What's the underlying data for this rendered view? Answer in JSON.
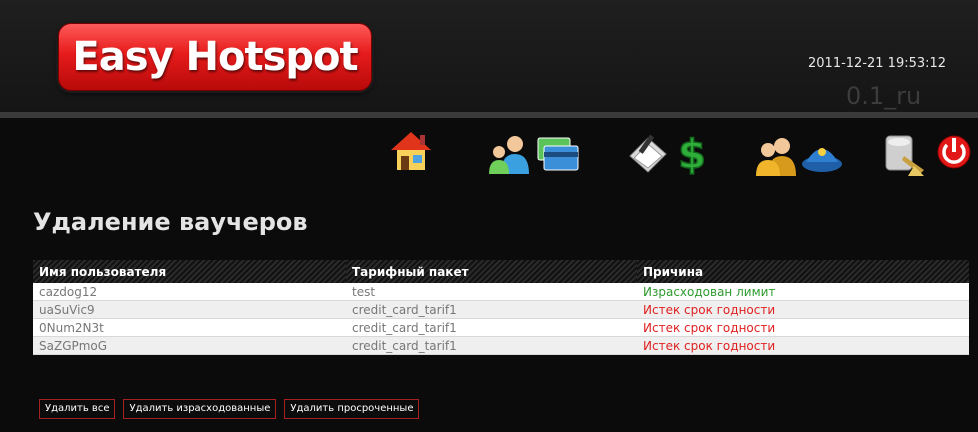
{
  "header": {
    "logo_text": "Easy Hotspot",
    "datetime": "2011-12-21 19:53:12",
    "version": "0.1_ru"
  },
  "toolbar": {
    "icons": [
      "home-icon",
      "users-icon",
      "cards-icon",
      "vouchers-icon",
      "billing-icon",
      "accounts-icon",
      "admin-icon",
      "maintenance-icon",
      "power-icon"
    ]
  },
  "page_title": "Удаление ваучеров",
  "table": {
    "headers": [
      "Имя пользователя",
      "Тарифный пакет",
      "Причина"
    ],
    "rows": [
      {
        "user": "cazdog12",
        "plan": "test",
        "reason": "Израсходован лимит"
      },
      {
        "user": "uaSuVic9",
        "plan": "credit_card_tarif1",
        "reason": "Истек срок годности"
      },
      {
        "user": "0Num2N3t",
        "plan": "credit_card_tarif1",
        "reason": "Истек срок годности"
      },
      {
        "user": "SaZGPmoG",
        "plan": "credit_card_tarif1",
        "reason": "Истек срок годности"
      }
    ]
  },
  "buttons": {
    "delete_all": "Удалить все",
    "delete_used": "Удалить израсходованные",
    "delete_expired": "Удалить просроченные"
  },
  "colors": {
    "used": "#2e9a2e",
    "expired": "#e02020",
    "logo": "#e61b1b"
  }
}
